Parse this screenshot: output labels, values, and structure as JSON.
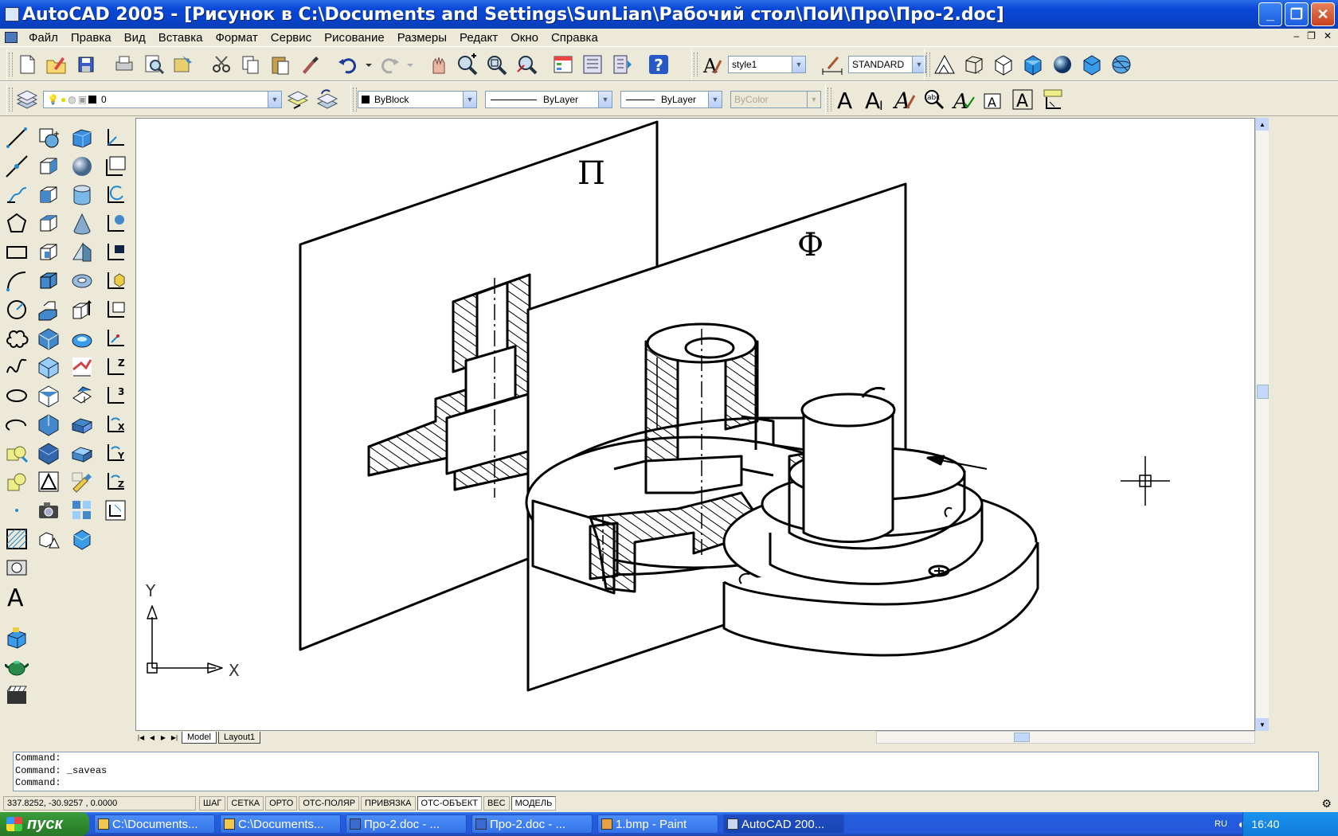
{
  "window": {
    "title": "AutoCAD 2005 - [Рисунок в C:\\Documents and Settings\\SunLian\\Рабочий стол\\ПоИ\\Про\\Про-2.doc]",
    "min": "_",
    "max": "❐",
    "close": "✕"
  },
  "menu": [
    "Файл",
    "Правка",
    "Вид",
    "Вставка",
    "Формат",
    "Сервис",
    "Рисование",
    "Размеры",
    "Редакт",
    "Окно",
    "Справка"
  ],
  "mdi": {
    "min": "–",
    "restore": "❐",
    "close": "✕"
  },
  "toolbar": {
    "text_style": "style1",
    "dim_style": "STANDARD",
    "layer": "0",
    "color": "ByBlock",
    "linetype": "ByLayer",
    "lineweight": "ByLayer",
    "plotstyle": "ByColor"
  },
  "drawing": {
    "plane_p_label": "П",
    "plane_f_label": "Ф",
    "ucs_y": "Y",
    "ucs_x": "X"
  },
  "tabs": [
    "Model",
    "Layout1"
  ],
  "command": {
    "lines": [
      "Command:",
      "Command: _saveas",
      "Command:"
    ]
  },
  "status": {
    "coords": "337.8252, -30.9257 , 0.0000",
    "buttons": [
      "ШАГ",
      "СЕТКА",
      "ОРТО",
      "ОТС-ПОЛЯР",
      "ПРИВЯЗКА",
      "ОТС-ОБЪЕКТ",
      "ВЕС",
      "МОДЕЛЬ"
    ]
  },
  "taskbar": {
    "start": "пуск",
    "tasks": [
      "C:\\Documents...",
      "C:\\Documents...",
      "Про-2.doc - ...",
      "Про-2.doc - ...",
      "1.bmp - Paint",
      "AutoCAD 200..."
    ],
    "lang": "RU",
    "time": "16:40"
  }
}
